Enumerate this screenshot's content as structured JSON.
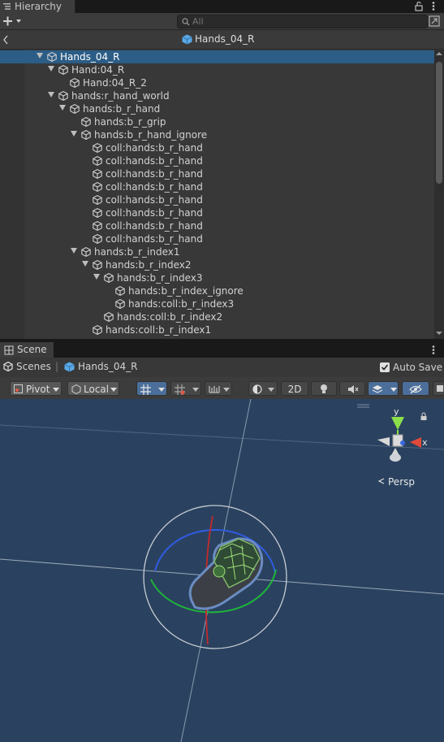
{
  "hierarchy": {
    "tab_label": "Hierarchy",
    "search_placeholder": "All",
    "header_title": "Hands_04_R",
    "rows": [
      {
        "label": "Hands_04_R",
        "depth": 0,
        "arrow": true,
        "selected": true
      },
      {
        "label": "Hand:04_R",
        "depth": 1,
        "arrow": true
      },
      {
        "label": "Hand:04_R_2",
        "depth": 2,
        "arrow": false
      },
      {
        "label": "hands:r_hand_world",
        "depth": 1,
        "arrow": true
      },
      {
        "label": "hands:b_r_hand",
        "depth": 2,
        "arrow": true
      },
      {
        "label": "hands:b_r_grip",
        "depth": 3,
        "arrow": false
      },
      {
        "label": "hands:b_r_hand_ignore",
        "depth": 3,
        "arrow": true
      },
      {
        "label": "coll:hands:b_r_hand",
        "depth": 4,
        "arrow": false
      },
      {
        "label": "coll:hands:b_r_hand",
        "depth": 4,
        "arrow": false
      },
      {
        "label": "coll:hands:b_r_hand",
        "depth": 4,
        "arrow": false
      },
      {
        "label": "coll:hands:b_r_hand",
        "depth": 4,
        "arrow": false
      },
      {
        "label": "coll:hands:b_r_hand",
        "depth": 4,
        "arrow": false
      },
      {
        "label": "coll:hands:b_r_hand",
        "depth": 4,
        "arrow": false
      },
      {
        "label": "coll:hands:b_r_hand",
        "depth": 4,
        "arrow": false
      },
      {
        "label": "coll:hands:b_r_hand",
        "depth": 4,
        "arrow": false
      },
      {
        "label": "hands:b_r_index1",
        "depth": 3,
        "arrow": true
      },
      {
        "label": "hands:b_r_index2",
        "depth": 4,
        "arrow": true
      },
      {
        "label": "hands:b_r_index3",
        "depth": 5,
        "arrow": true
      },
      {
        "label": "hands:b_r_index_ignore",
        "depth": 6,
        "arrow": false
      },
      {
        "label": "hands:coll:b_r_index3",
        "depth": 6,
        "arrow": false
      },
      {
        "label": "hands:coll:b_r_index2",
        "depth": 5,
        "arrow": false
      },
      {
        "label": "hands:coll:b_r_index1",
        "depth": 4,
        "arrow": false
      }
    ]
  },
  "scene": {
    "tab_label": "Scene",
    "breadcrumb_root": "Scenes",
    "breadcrumb_object": "Hands_04_R",
    "auto_save_label": "Auto Save",
    "auto_save_checked": true,
    "pivot_label": "Pivot",
    "local_label": "Local",
    "mode_2d_label": "2D",
    "gizmo_y": "y",
    "gizmo_x": "x",
    "persp_label": "Persp"
  }
}
